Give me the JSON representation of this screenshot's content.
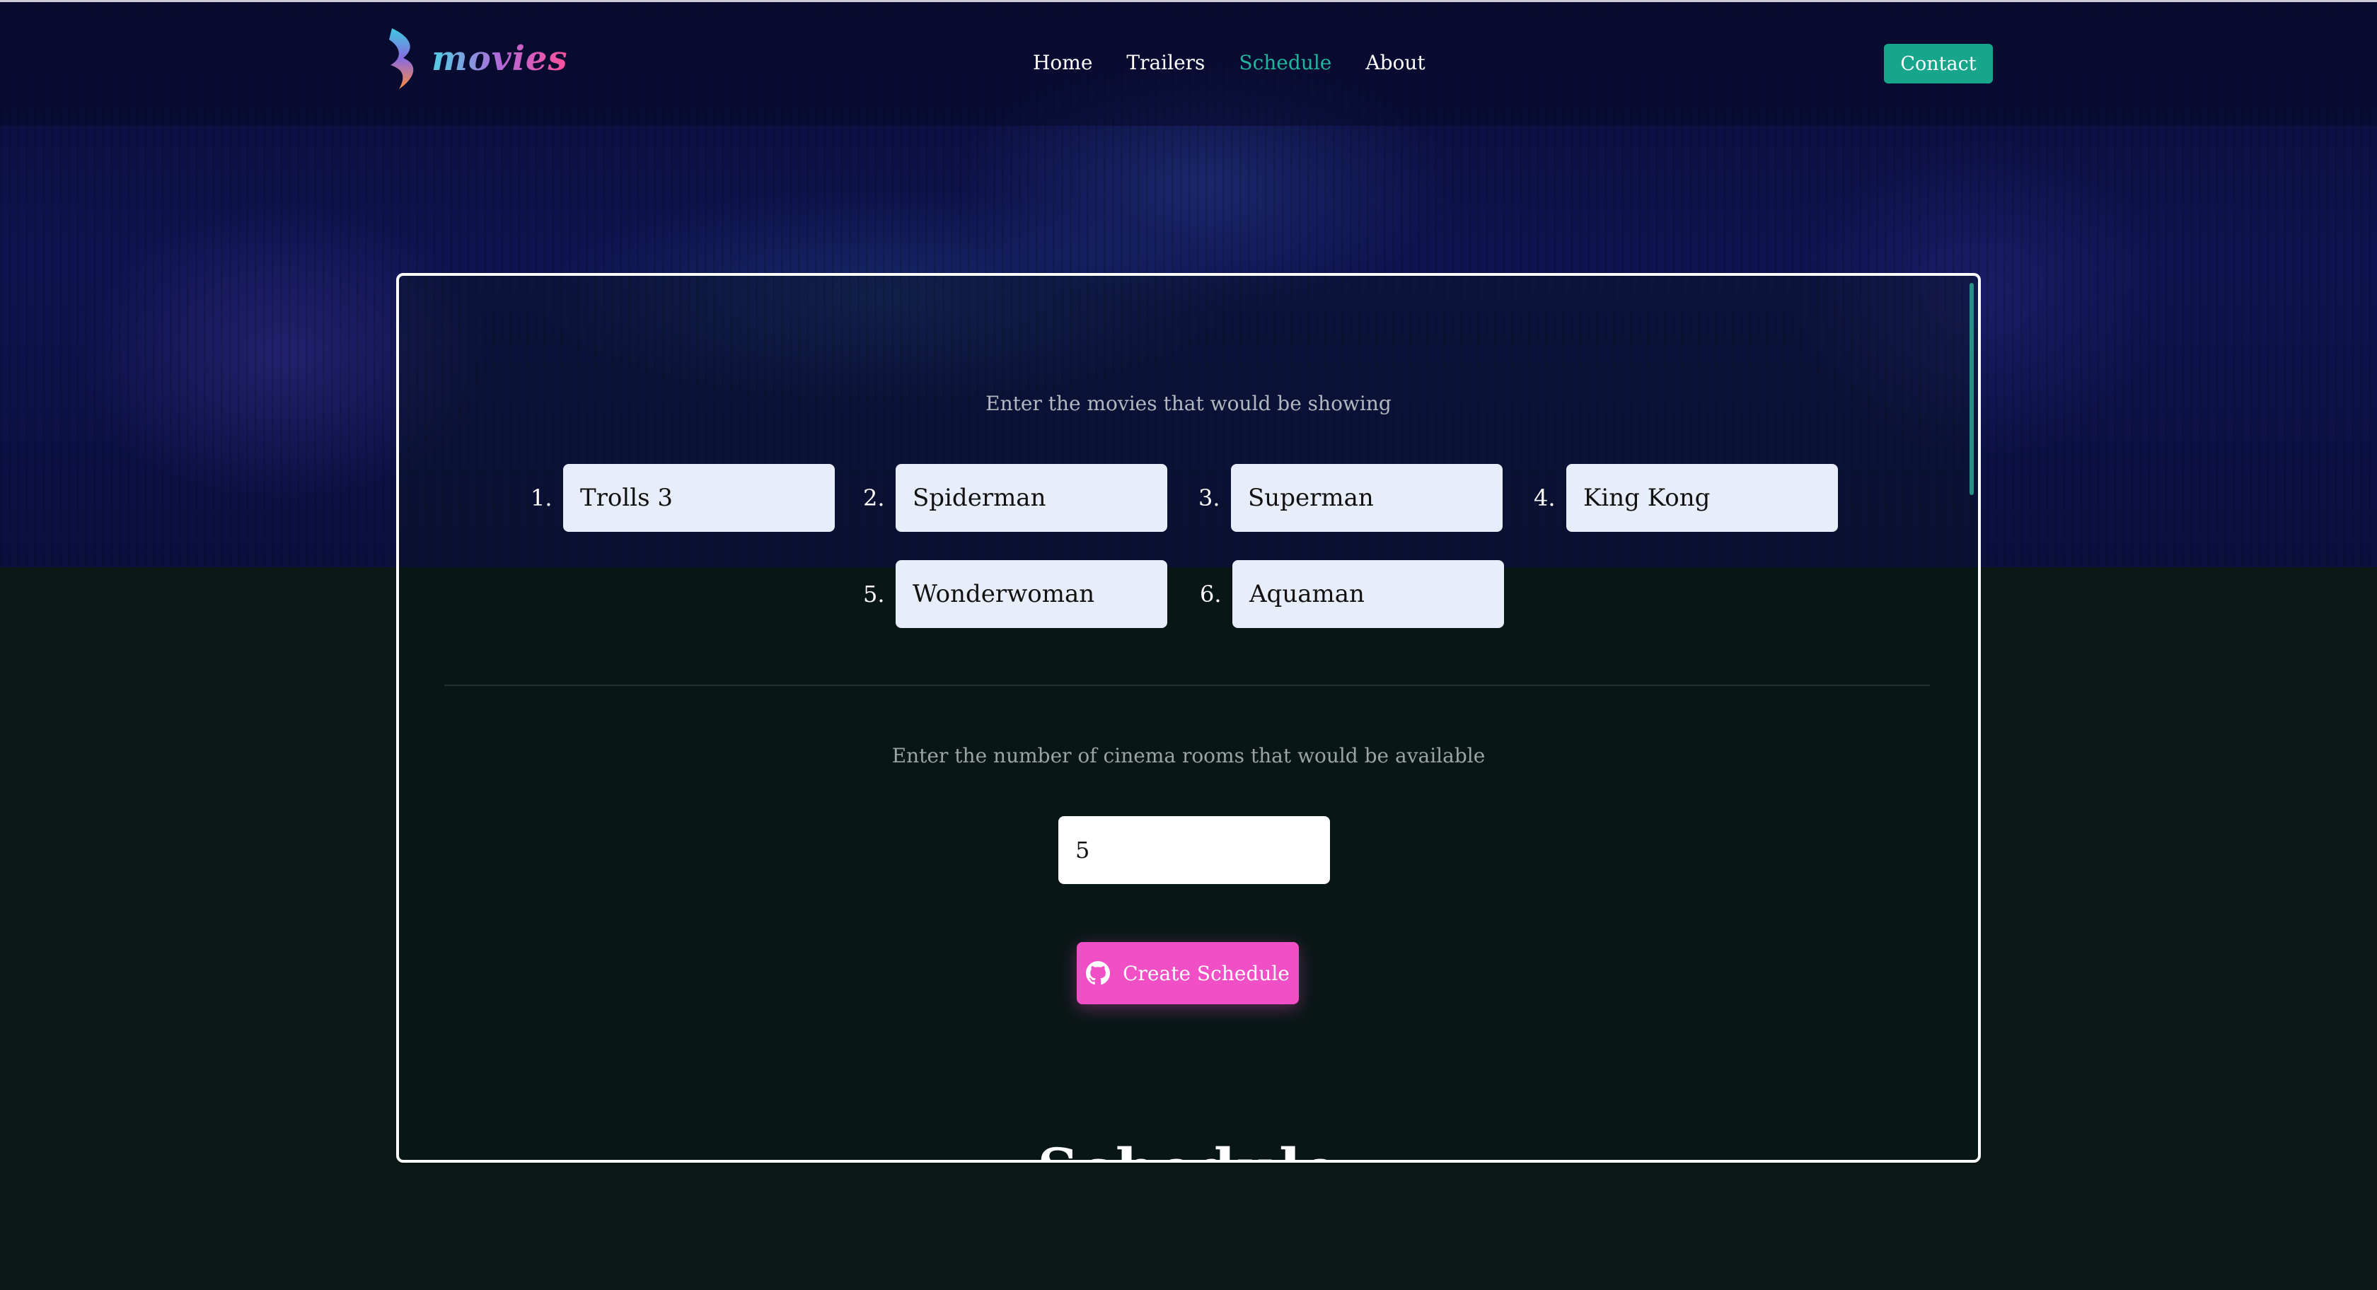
{
  "header": {
    "logo_text": "movies",
    "nav": [
      {
        "label": "Home"
      },
      {
        "label": "Trailers"
      },
      {
        "label": "Schedule",
        "active": true
      },
      {
        "label": "About"
      }
    ],
    "contact_label": "Contact"
  },
  "form": {
    "movies_prompt": "Enter the movies that would be showing",
    "movies": [
      {
        "num": "1.",
        "title": "Trolls 3"
      },
      {
        "num": "2.",
        "title": "Spiderman"
      },
      {
        "num": "3.",
        "title": "Superman"
      },
      {
        "num": "4.",
        "title": "King Kong"
      },
      {
        "num": "5.",
        "title": "Wonderwoman"
      },
      {
        "num": "6.",
        "title": "Aquaman"
      }
    ],
    "rooms_prompt": "Enter the number of cinema rooms that would be available",
    "rooms_value": "5",
    "create_label": "Create Schedule",
    "create_icon": "github-icon"
  },
  "schedule_heading": "Schedule",
  "colors": {
    "accent": "#1fb69e",
    "contact_bg": "#17a58c",
    "create_bg": "#f04fc6",
    "field_bg": "#e8edfa",
    "page_bg": "#0a1714"
  }
}
